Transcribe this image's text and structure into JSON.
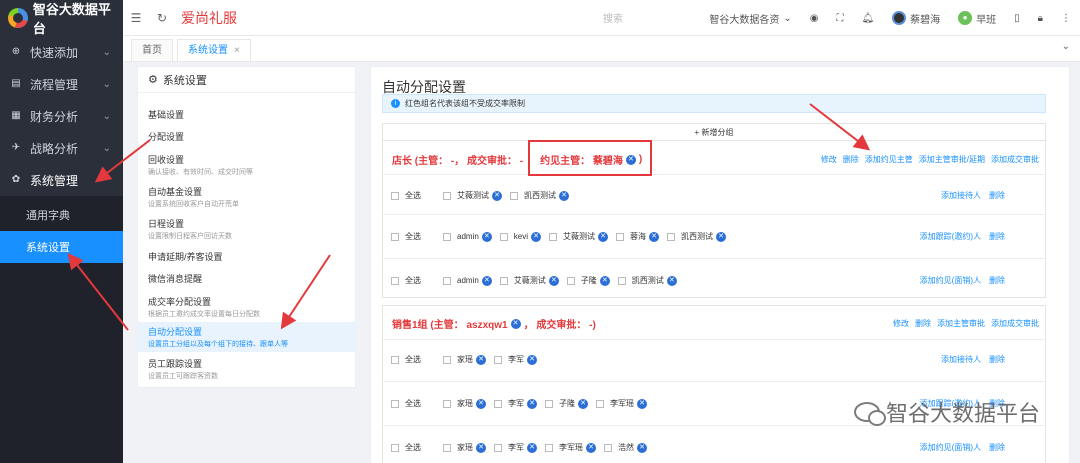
{
  "app": {
    "logo_text": "智谷大数据平台",
    "brand": "爱尚礼服"
  },
  "sidebar": {
    "items": [
      {
        "label": "快速添加",
        "icon": "plus-circle-icon"
      },
      {
        "label": "流程管理",
        "icon": "flow-icon"
      },
      {
        "label": "财务分析",
        "icon": "chart-icon"
      },
      {
        "label": "战略分析",
        "icon": "plane-icon"
      },
      {
        "label": "系统管理",
        "icon": "gear-icon"
      }
    ],
    "sub": [
      {
        "label": "通用字典"
      },
      {
        "label": "系统设置"
      }
    ]
  },
  "topbar": {
    "search_placeholder": "搜索",
    "org": "智谷大数据各资",
    "user": "蔡碧海",
    "user2": "早班"
  },
  "tabs": [
    {
      "label": "首页"
    },
    {
      "label": "系统设置"
    }
  ],
  "settings": {
    "title": "系统设置",
    "items": [
      {
        "label": "基础设置",
        "desc": ""
      },
      {
        "label": "分配设置",
        "desc": ""
      },
      {
        "label": "回收设置",
        "desc": "确认接收、有效时间、成交时间等"
      },
      {
        "label": "自动基金设置",
        "desc": "设置系统回收客户自动开荒单"
      },
      {
        "label": "日程设置",
        "desc": "设置限制日程客户回访天数"
      },
      {
        "label": "申请延期/养客设置",
        "desc": ""
      },
      {
        "label": "微信消息提醒",
        "desc": ""
      },
      {
        "label": "成交率分配设置",
        "desc": "根据员工邀约成交率设置每日分配数"
      },
      {
        "label": "自动分配设置",
        "desc": "设置员工分组以及每个组下的接待、跟单人等"
      },
      {
        "label": "员工跟踪设置",
        "desc": "设置员工可跟踪客资数"
      }
    ]
  },
  "main": {
    "title": "自动分配设置",
    "notice": "红色组名代表该组不受成交率限制",
    "add_group": "+ 新增分组",
    "groups": [
      {
        "title_part1": "店长 (主管： -， 成交审批： -",
        "title_part2": "约见主管： 蔡碧海",
        "title_part3": ")",
        "actions": [
          "修改",
          "删除",
          "添加约见主管",
          "添加主管审批/延期",
          "添加成交审批"
        ],
        "rows": [
          {
            "check": "全选",
            "members": [
              "艾薇测试",
              "凯西测试"
            ],
            "actions": [
              "添加接待人",
              "删除"
            ]
          },
          {
            "check": "全选",
            "members": [
              "admin",
              "kevi",
              "艾薇测试",
              "蓉海",
              "凯西测试"
            ],
            "actions": [
              "添加跟踪(邀约)人",
              "删除"
            ]
          },
          {
            "check": "全选",
            "members": [
              "admin",
              "艾薇测试",
              "子隆",
              "凯西测试"
            ],
            "actions": [
              "添加约见(面销)人",
              "删除"
            ]
          }
        ]
      },
      {
        "title_part1": "销售1组 (主管： aszxqw1",
        "title_part2": "， 成交审批： -)",
        "actions": [
          "修改",
          "删除",
          "添加主管审批",
          "添加成交审批"
        ],
        "rows": [
          {
            "check": "全选",
            "members": [
              "家瑶",
              "李军"
            ],
            "actions": [
              "添加接待人",
              "删除"
            ]
          },
          {
            "check": "全选",
            "members": [
              "家瑶",
              "李军",
              "子隆",
              "李军瑶"
            ],
            "actions": [
              "添加跟踪(邀约)人",
              "删除"
            ]
          },
          {
            "check": "全选",
            "members": [
              "家瑶",
              "李军",
              "李军瑶",
              "浩然"
            ],
            "actions": [
              "添加约见(面销)人",
              "删除"
            ]
          }
        ]
      }
    ]
  },
  "watermark": "智谷大数据平台",
  "colors": {
    "accent": "#1890ff",
    "sidebar": "#2b2f3a",
    "danger": "#e4393c"
  }
}
